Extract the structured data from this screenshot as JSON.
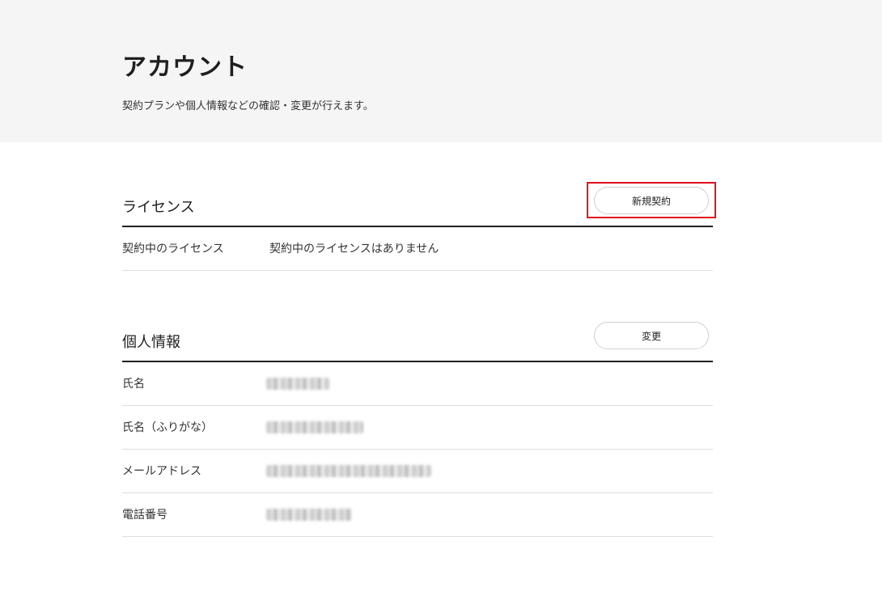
{
  "header": {
    "title": "アカウント",
    "description": "契約プランや個人情報などの確認・変更が行えます。"
  },
  "license": {
    "title": "ライセンス",
    "button_label": "新規契約",
    "rows": [
      {
        "label": "契約中のライセンス",
        "value": "契約中のライセンスはありません"
      }
    ]
  },
  "personal": {
    "title": "個人情報",
    "button_label": "変更",
    "rows": [
      {
        "label": "氏名"
      },
      {
        "label": "氏名（ふりがな）"
      },
      {
        "label": "メールアドレス"
      },
      {
        "label": "電話番号"
      }
    ]
  },
  "colors": {
    "header_background": "#f5f5f5",
    "highlight_border": "#e0101c",
    "rule": "#1f1f1f",
    "divider": "#dddddd"
  }
}
